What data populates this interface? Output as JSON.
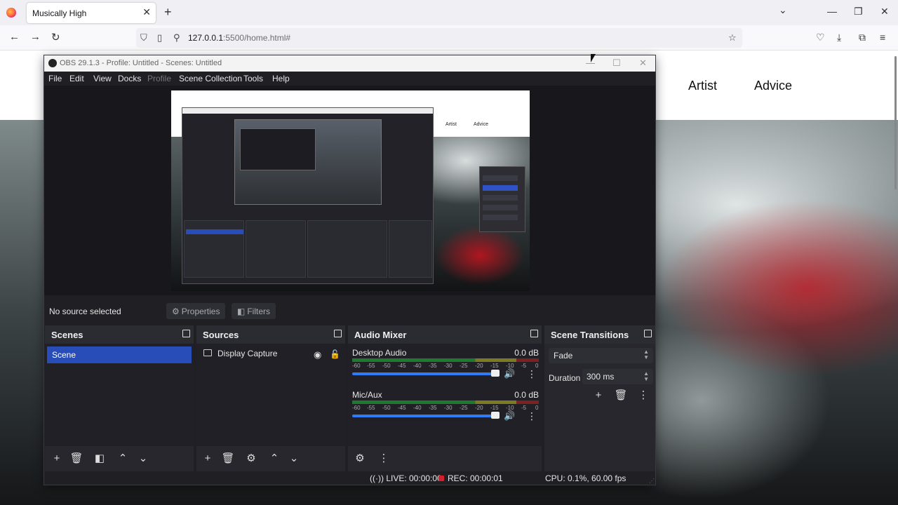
{
  "browser": {
    "tab_title": "Musically High",
    "tab_close": "✕",
    "new_tab": "+",
    "url_host": "127.0.0.1",
    "url_path": ":5500/home.html#",
    "list_tabs": "⌄",
    "minimize": "—",
    "restore": "❐",
    "close": "✕"
  },
  "page": {
    "nav": [
      "Artist",
      "Advice"
    ]
  },
  "obs": {
    "title": "OBS 29.1.3 - Profile: Untitled - Scenes: Untitled",
    "menu": [
      "File",
      "Edit",
      "View",
      "Docks",
      "Profile",
      "Scene Collection",
      "Tools",
      "Help"
    ],
    "no_source": "No source selected",
    "properties": "Properties",
    "filters": "Filters",
    "docks": {
      "scenes": {
        "title": "Scenes",
        "items": [
          "Scene"
        ]
      },
      "sources": {
        "title": "Sources",
        "items": [
          "Display Capture"
        ]
      },
      "mixer": {
        "title": "Audio Mixer",
        "channels": [
          {
            "name": "Desktop Audio",
            "db": "0.0 dB"
          },
          {
            "name": "Mic/Aux",
            "db": "0.0 dB"
          }
        ],
        "ticks": [
          "-60",
          "-55",
          "-50",
          "-45",
          "-40",
          "-35",
          "-30",
          "-25",
          "-20",
          "-15",
          "-10",
          "-5",
          "0"
        ]
      },
      "transitions": {
        "title": "Scene Transitions",
        "type": "Fade",
        "duration_label": "Duration",
        "duration": "300 ms"
      }
    },
    "status": {
      "live": "LIVE: 00:00:00",
      "rec": "REC: 00:00:01",
      "cpu": "CPU: 0.1%, 60.00 fps"
    },
    "preview": {
      "nav": [
        "Artist",
        "Advice"
      ]
    }
  },
  "colors": {
    "accent": "#284cb8",
    "rec": "#d4202c",
    "firefox": "#ff7139"
  }
}
